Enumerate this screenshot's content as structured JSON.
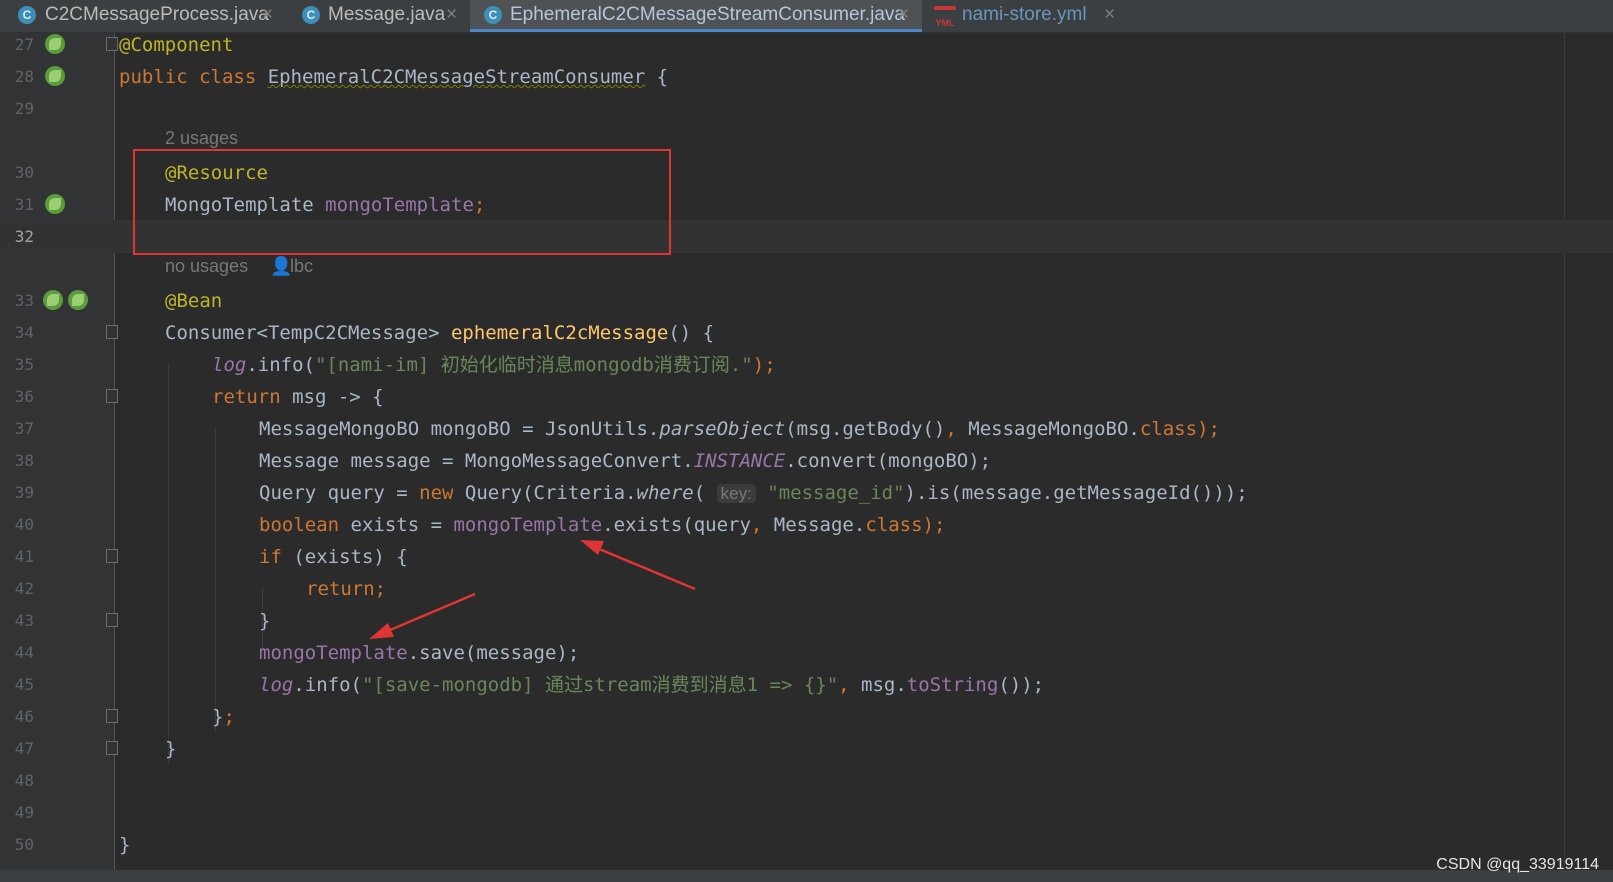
{
  "tabs": [
    {
      "icon": "C",
      "label": "C2CMessageProcess.java",
      "close": "×"
    },
    {
      "icon": "C",
      "label": "Message.java",
      "close": "×"
    },
    {
      "icon": "C",
      "label": "EphemeralC2CMessageStreamConsumer.java",
      "close": "×",
      "active": true
    },
    {
      "icon": "YML",
      "label": "nami-store.yml",
      "close": "×"
    }
  ],
  "lines": {
    "l27": {
      "n": "27",
      "t1": "@Component"
    },
    "l28": {
      "n": "28",
      "kw": "public class",
      "name": "EphemeralC2CMessageStreamConsumer",
      "rest": " {"
    },
    "l29": {
      "n": "29"
    },
    "hint1": {
      "text": "2 usages"
    },
    "l30": {
      "n": "30",
      "ann": "@Resource"
    },
    "l31": {
      "n": "31",
      "type": "MongoTemplate",
      "field": "mongoTemplate",
      "semi": ";"
    },
    "l32": {
      "n": "32"
    },
    "hint2": {
      "usages": "no usages",
      "author": "lbc"
    },
    "l33": {
      "n": "33",
      "ann": "@Bean"
    },
    "l34": {
      "n": "34",
      "a": "Consumer<TempC2CMessage> ",
      "fn": "ephemeralC2cMessage",
      "b": "() {"
    },
    "l35": {
      "n": "35",
      "log": "log",
      "a": ".info(",
      "str": "\"[nami-im] 初始化临时消息mongodb消费订阅.\"",
      "b": ");"
    },
    "l36": {
      "n": "36",
      "kw": "return",
      "a": " msg -> {"
    },
    "l37": {
      "n": "37",
      "a": "MessageMongoBO mongoBO = JsonUtils.",
      "it": "parseObject",
      "b": "(msg.getBody()",
      "c": ",",
      "d": " MessageMongoBO.",
      "kw": "class",
      "e": ");"
    },
    "l38": {
      "n": "38",
      "a": "Message message = MongoMessageConvert.",
      "sf": "INSTANCE",
      "b": ".convert(mongoBO);"
    },
    "l39": {
      "n": "39",
      "a": "Query query = ",
      "kw": "new",
      "b": " Query(Criteria.",
      "it": "where",
      "c": "( ",
      "key": "key:",
      "str": "\"message_id\"",
      "d": ").is(message.getMessageId()));"
    },
    "l40": {
      "n": "40",
      "kw": "boolean",
      "a": " exists = ",
      "field": "mongoTemplate",
      "b": ".exists(query",
      "c": ",",
      "d": " Message.",
      "kw2": "class",
      "e": ");"
    },
    "l41": {
      "n": "41",
      "kw": "if",
      "a": " (exists) {"
    },
    "l42": {
      "n": "42",
      "kw": "return",
      "a": ";"
    },
    "l43": {
      "n": "43",
      "a": "}"
    },
    "l44": {
      "n": "44",
      "field": "mongoTemplate",
      "a": ".save(message);"
    },
    "l45": {
      "n": "45",
      "log": "log",
      "a": ".info(",
      "str": "\"[save-mongodb] 通过stream消费到消息1 => {}\"",
      "c": ",",
      "b": " msg.",
      "fld": "toString",
      "d": "());"
    },
    "l46": {
      "n": "46",
      "a": "}",
      "semi": ";"
    },
    "l47": {
      "n": "47",
      "a": "}"
    },
    "l48": {
      "n": "48"
    },
    "l49": {
      "n": "49"
    },
    "l50": {
      "n": "50",
      "a": "}"
    }
  },
  "watermark": "CSDN @qq_33919114",
  "colors": {
    "highlight_box": "#e03535",
    "arrow": "#e03535"
  }
}
